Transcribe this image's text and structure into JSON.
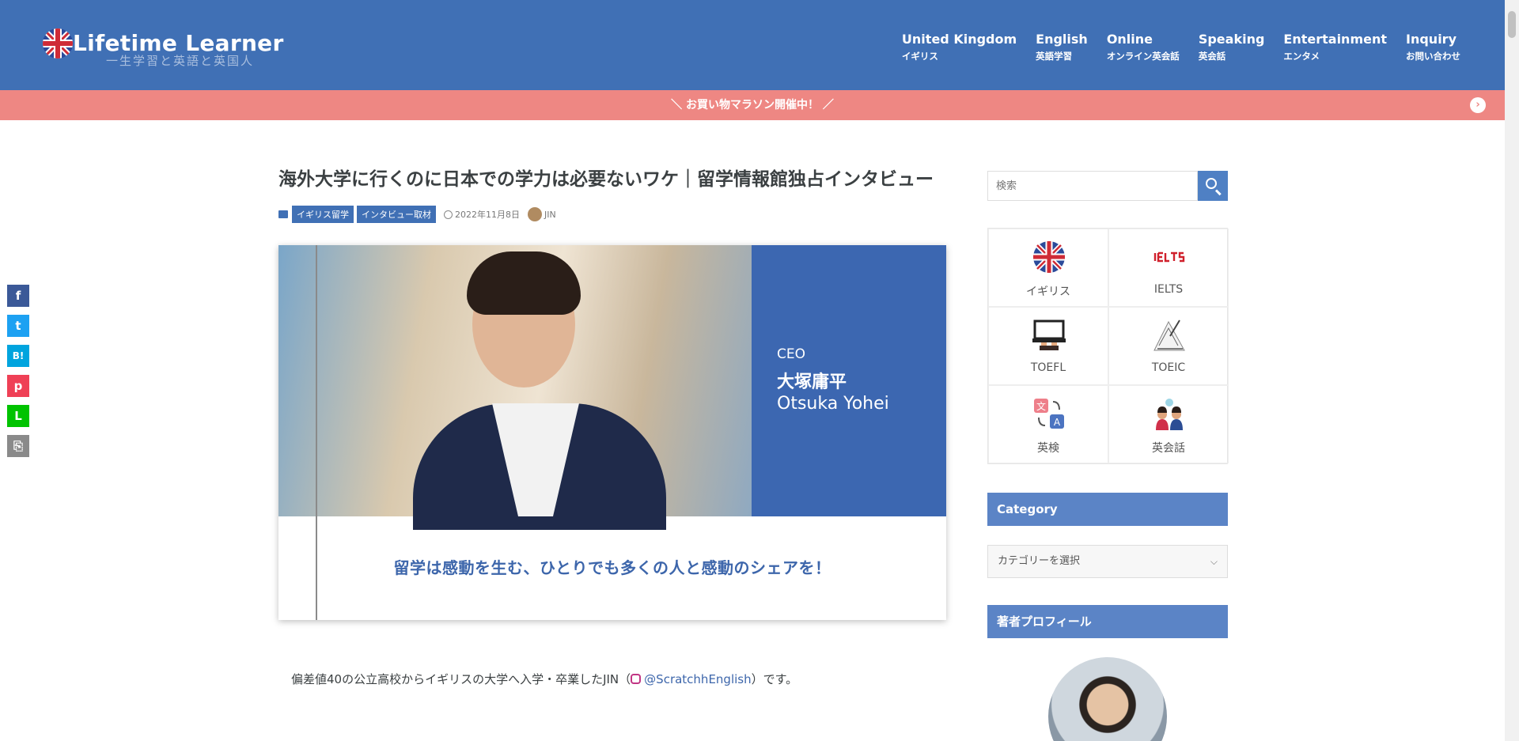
{
  "header": {
    "logo_text": "Lifetime Learner",
    "logo_sub": "一生学習と英語と英国人",
    "nav": [
      {
        "en": "United Kingdom",
        "ja": "イギリス"
      },
      {
        "en": "English",
        "ja": "英語学習"
      },
      {
        "en": "Online",
        "ja": "オンライン英会話"
      },
      {
        "en": "Speaking",
        "ja": "英会話"
      },
      {
        "en": "Entertainment",
        "ja": "エンタメ"
      },
      {
        "en": "Inquiry",
        "ja": "お問い合わせ"
      }
    ]
  },
  "infobar": {
    "text": "＼ お買い物マラソン開催中！ ／",
    "arrow": "›"
  },
  "share": [
    "f",
    "t",
    "B!",
    "p",
    "L",
    "⎘"
  ],
  "article": {
    "title": "海外大学に行くのに日本での学力は必要ないワケ｜留学情報館独占インタビュー",
    "categories": [
      "イギリス留学",
      "インタビュー取材"
    ],
    "date": "2022年11月8日",
    "author": "JIN",
    "hero": {
      "ceo_label": "CEO",
      "name_ja": "大塚庸平",
      "name_en": "Otsuka Yohei",
      "tagline": "留学は感動を生む、ひとりでも多くの人と感動のシェアを！"
    },
    "intro_before": "偏差値40の公立高校からイギリスの大学へ入学・卒業したJIN（",
    "intro_link": "@ScratchhEnglish",
    "intro_after": "）です。"
  },
  "sidebar": {
    "search_placeholder": "検索",
    "tiles": [
      {
        "label": "イギリス",
        "icon": "union-jack-icon"
      },
      {
        "label": "IELTS",
        "icon": "ielts-logo-icon"
      },
      {
        "label": "TOEFL",
        "icon": "laptop-icon"
      },
      {
        "label": "TOEIC",
        "icon": "writing-icon"
      },
      {
        "label": "英検",
        "icon": "translate-icon"
      },
      {
        "label": "英会話",
        "icon": "conversation-icon"
      }
    ],
    "category_heading": "Category",
    "category_select": "カテゴリーを選択",
    "profile_heading": "著者プロフィール"
  },
  "colors": {
    "header_blue": "#4070b5",
    "infobar_pink": "#ee8783",
    "panel_blue": "#3c67b1",
    "widget_blue": "#5b84c6"
  }
}
